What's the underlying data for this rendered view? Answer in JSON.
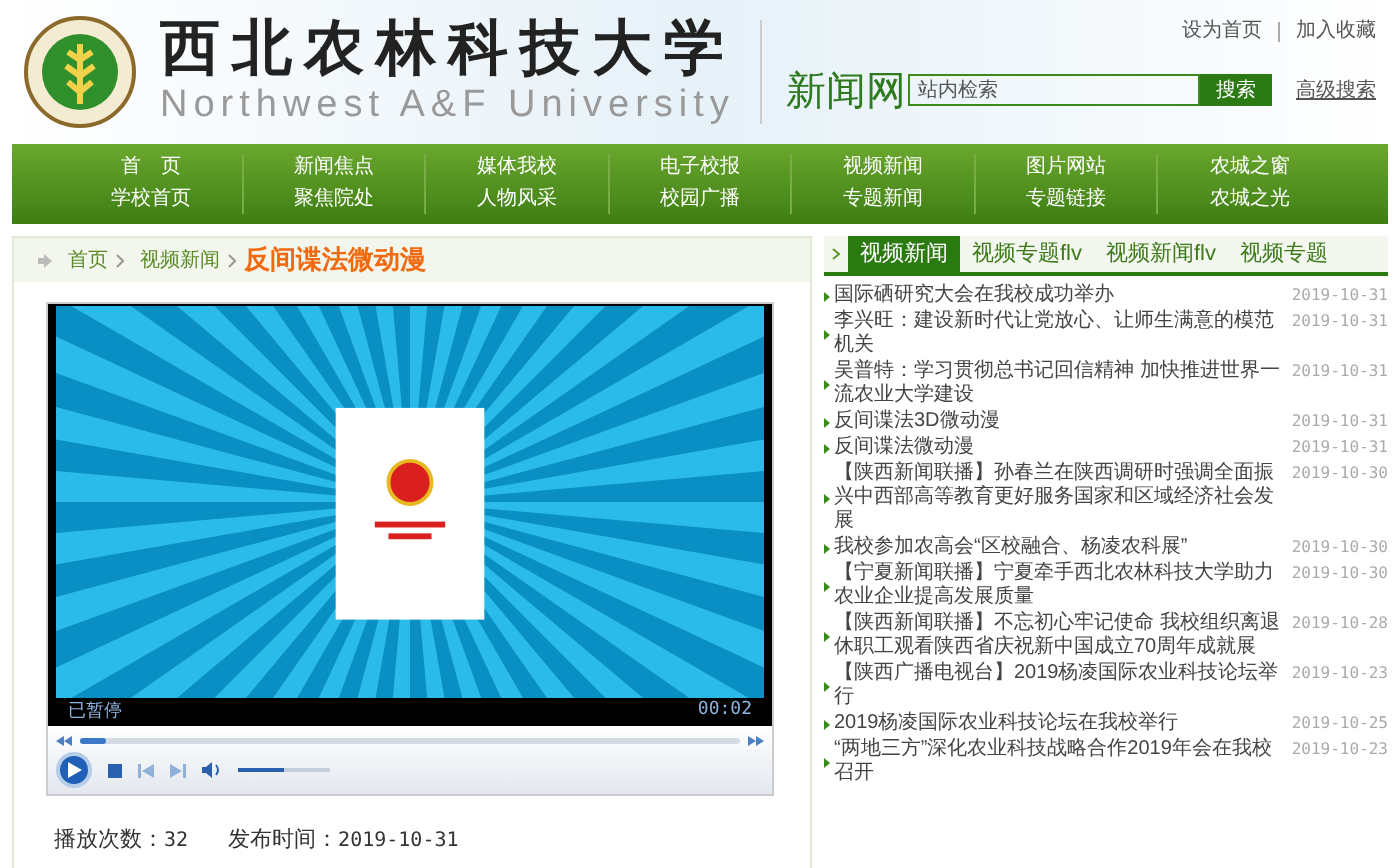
{
  "header": {
    "logo_title": "西北农林科技大学",
    "logo_subtitle": "Northwest A&F University",
    "site_name": "新闻网",
    "top_links": [
      "设为首页",
      "加入收藏"
    ],
    "search": {
      "placeholder": "站内检索",
      "button": "搜索",
      "advanced": "高级搜索"
    }
  },
  "nav": [
    [
      "首　页",
      "学校首页"
    ],
    [
      "新闻焦点",
      "聚焦院处"
    ],
    [
      "媒体我校",
      "人物风采"
    ],
    [
      "电子校报",
      "校园广播"
    ],
    [
      "视频新闻",
      "专题新闻"
    ],
    [
      "图片网站",
      "专题链接"
    ],
    [
      "农城之窗",
      "农城之光"
    ]
  ],
  "breadcrumb": {
    "items": [
      "首页",
      "视频新闻"
    ],
    "current": "反间谍法微动漫"
  },
  "player": {
    "status": "已暂停",
    "time": "00:02",
    "progress": {
      "level": 0.04
    },
    "volume": {
      "level": 0.5
    }
  },
  "stats": {
    "plays_label": "播放次数：",
    "plays": "32",
    "date_label": "发布时间：",
    "date": "2019-10-31"
  },
  "tabs": [
    {
      "label": "视频新闻",
      "selected": true
    },
    {
      "label": "视频专题flv",
      "selected": false
    },
    {
      "label": "视频新闻flv",
      "selected": false
    },
    {
      "label": "视频专题",
      "selected": false
    }
  ],
  "news": [
    {
      "title": "国际硒研究大会在我校成功举办",
      "date": "2019-10-31"
    },
    {
      "title": "李兴旺：建设新时代让党放心、让师生满意的模范机关",
      "date": "2019-10-31"
    },
    {
      "title": "吴普特：学习贯彻总书记回信精神 加快推进世界一流农业大学建设",
      "date": "2019-10-31"
    },
    {
      "title": "反间谍法3D微动漫",
      "date": "2019-10-31"
    },
    {
      "title": "反间谍法微动漫",
      "date": "2019-10-31"
    },
    {
      "title": "【陕西新闻联播】孙春兰在陕西调研时强调全面振兴中西部高等教育更好服务国家和区域经济社会发展",
      "date": "2019-10-30"
    },
    {
      "title": "我校参加农高会“区校融合、杨凌农科展”",
      "date": "2019-10-30"
    },
    {
      "title": "【宁夏新闻联播】宁夏牵手西北农林科技大学助力农业企业提高发展质量",
      "date": "2019-10-30"
    },
    {
      "title": "【陕西新闻联播】不忘初心牢记使命 我校组织离退休职工观看陕西省庆祝新中国成立70周年成就展",
      "date": "2019-10-28"
    },
    {
      "title": "【陕西广播电视台】2019杨凌国际农业科技论坛举行",
      "date": "2019-10-23"
    },
    {
      "title": "2019杨凌国际农业科技论坛在我校举行",
      "date": "2019-10-25"
    },
    {
      "title": "“两地三方”深化农业科技战略合作2019年会在我校召开",
      "date": "2019-10-23"
    }
  ]
}
